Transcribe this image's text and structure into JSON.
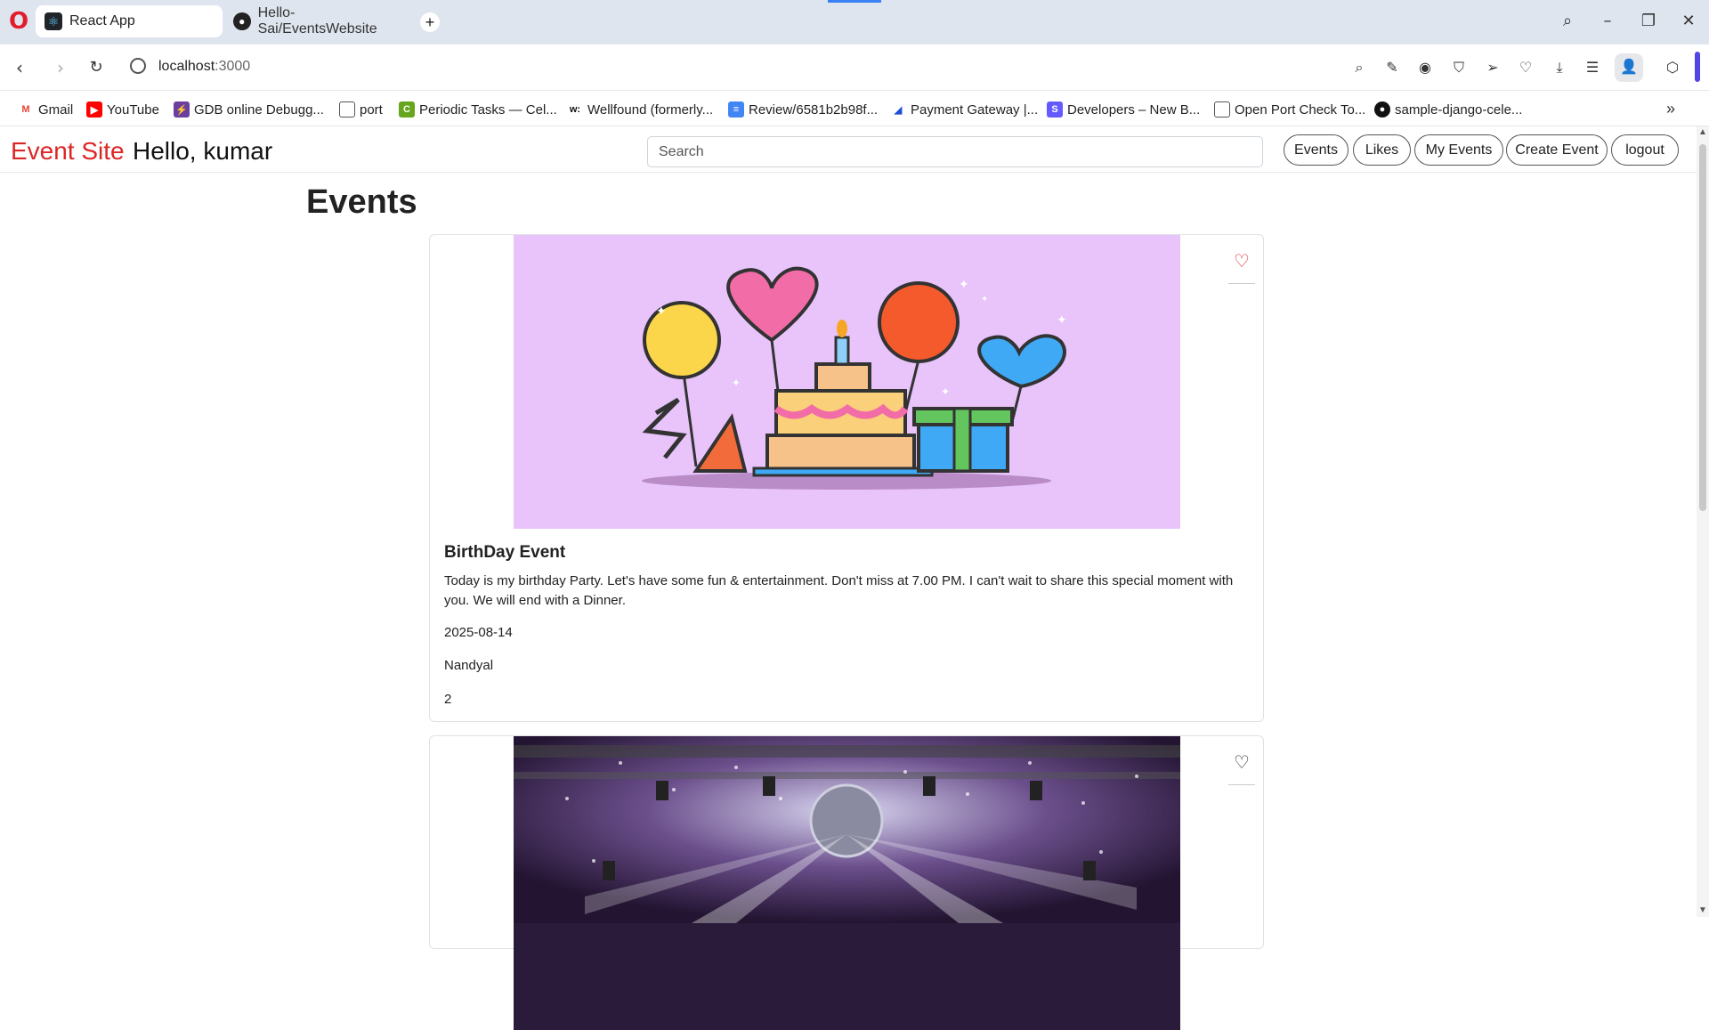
{
  "browser": {
    "tabs": [
      {
        "title": "React App",
        "active": true,
        "icon": "react-icon"
      },
      {
        "title": "Hello-Sai/EventsWebsite",
        "active": false,
        "icon": "github-icon"
      }
    ],
    "url_host": "localhost",
    "url_port": ":3000",
    "bookmarks": [
      {
        "label": "Gmail",
        "icon": "gmail-icon",
        "color": "#ea4335"
      },
      {
        "label": "YouTube",
        "icon": "youtube-icon",
        "color": "#ff0000"
      },
      {
        "label": "GDB online Debugg...",
        "icon": "gdb-icon",
        "color": "#6b3fa0"
      },
      {
        "label": "port",
        "icon": "file-icon",
        "color": "#555555"
      },
      {
        "label": "Periodic Tasks — Cel...",
        "icon": "celery-icon",
        "color": "#66a61e"
      },
      {
        "label": "Wellfound (formerly...",
        "icon": "wellfound-icon",
        "color": "#111111"
      },
      {
        "label": "Review/6581b2b98f...",
        "icon": "docs-icon",
        "color": "#4285f4"
      },
      {
        "label": "Payment Gateway |...",
        "icon": "razorpay-icon",
        "color": "#1d4ed8"
      },
      {
        "label": "Developers – New B...",
        "icon": "stripe-icon",
        "color": "#635bff"
      },
      {
        "label": "Open Port Check To...",
        "icon": "file-icon",
        "color": "#555555"
      },
      {
        "label": "sample-django-cele...",
        "icon": "github-icon",
        "color": "#111111"
      }
    ]
  },
  "site": {
    "brand": "Event Site",
    "greeting": "Hello, kumar",
    "search_placeholder": "Search",
    "nav": [
      "Events",
      "Likes",
      "My Events",
      "Create Event",
      "logout"
    ],
    "heading": "Events",
    "accent_color": "#dc2626"
  },
  "events": [
    {
      "title": "BirthDay Event",
      "description": "Today is my birthday Party. Let's have some fun & entertainment. Don't miss at 7.00 PM. I can't wait to share this special moment with you. We will end with a Dinner.",
      "date": "2025-08-14",
      "place": "Nandyal",
      "likes": "2",
      "liked": true,
      "image": "birthday-illustration"
    },
    {
      "title": "",
      "liked": false,
      "image": "party-disco-photo"
    }
  ]
}
